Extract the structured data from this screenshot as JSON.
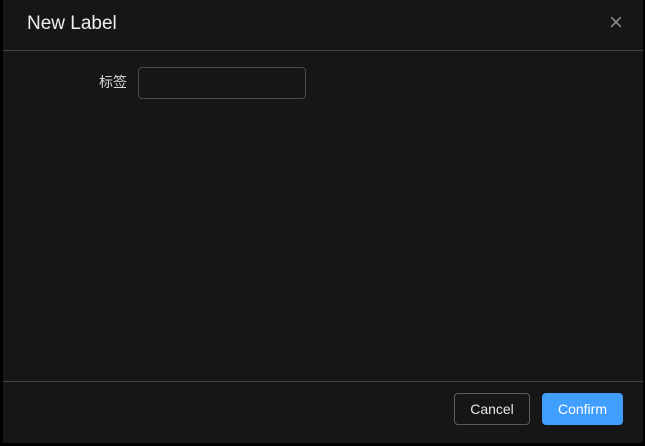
{
  "dialog": {
    "title": "New Label",
    "close_icon": "close-icon"
  },
  "form": {
    "label_field": {
      "label": "标签",
      "value": "",
      "placeholder": ""
    }
  },
  "footer": {
    "cancel_label": "Cancel",
    "confirm_label": "Confirm"
  },
  "colors": {
    "background": "#161616",
    "accent": "#409eff",
    "divider": "#454545"
  }
}
